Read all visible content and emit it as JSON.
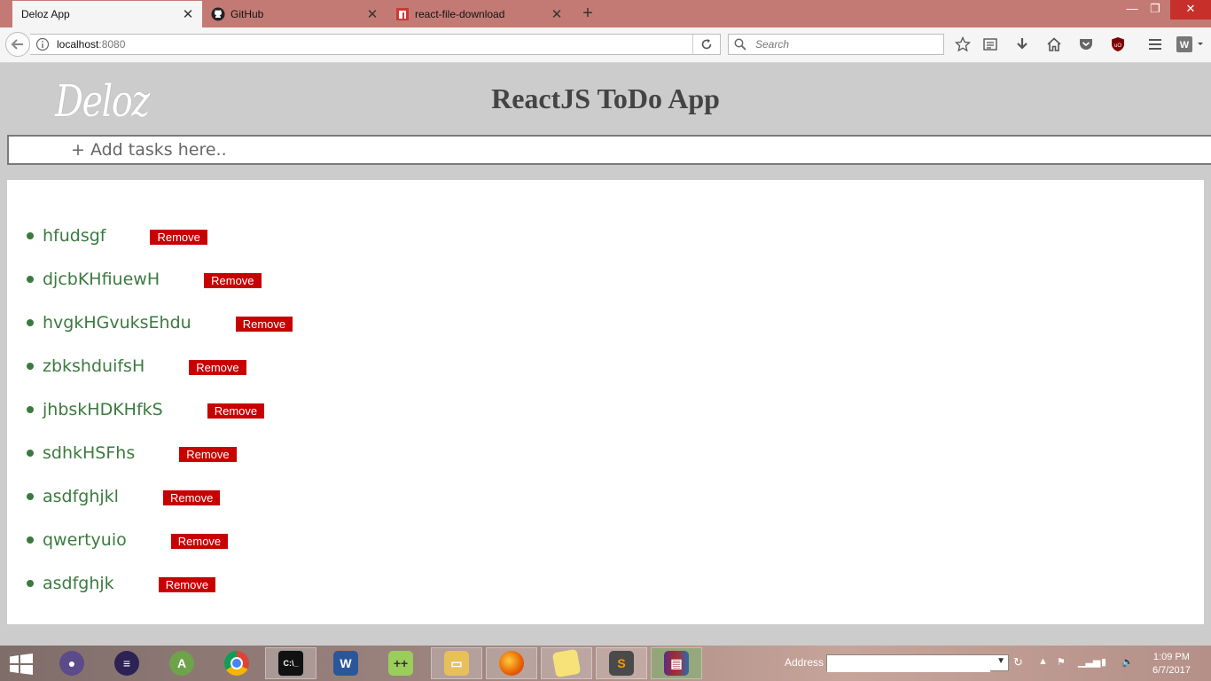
{
  "browser": {
    "tabs": [
      {
        "title": "Deloz App",
        "icon": "none",
        "active": true
      },
      {
        "title": "GitHub",
        "icon": "github-icon",
        "active": false
      },
      {
        "title": "react-file-download",
        "icon": "npm-icon",
        "active": false
      }
    ],
    "url_host": "localhost",
    "url_port": ":8080",
    "search_placeholder": "Search",
    "window_controls": {
      "minimize": "—",
      "restore": "❐",
      "close": "✕"
    },
    "accent_color": "#c47a74"
  },
  "app": {
    "logo": "Deloz",
    "title": "ReactJS ToDo App",
    "input_placeholder": "+ Add tasks here..",
    "remove_label": "Remove",
    "todos": [
      "hfudsgf",
      "djcbKHfiuewH",
      "hvgkHGvuksEhdu",
      "zbkshduifsH",
      "jhbskHDKHfkS",
      "sdhkHSFhs",
      "asdfghjkl",
      "qwertyuio",
      "asdfghjk"
    ],
    "todo_color": "#3b7a3f",
    "remove_color": "#c80000"
  },
  "taskbar": {
    "address_label": "Address",
    "time": "1:09 PM",
    "date": "6/7/2017"
  }
}
